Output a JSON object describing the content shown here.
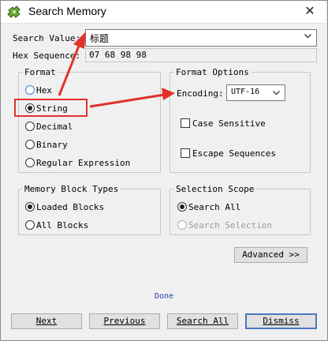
{
  "window": {
    "title": "Search Memory",
    "close_icon": "close-icon",
    "app_icon": "puzzle-icon"
  },
  "search": {
    "value_label": "Search Value:",
    "value": "标题",
    "hex_label": "Hex Sequence:",
    "hex_value": "07 68 98 98"
  },
  "format": {
    "legend": "Format",
    "options": [
      "Hex",
      "String",
      "Decimal",
      "Binary",
      "Regular Expression"
    ],
    "selected": "String"
  },
  "format_options": {
    "legend": "Format Options",
    "encoding_label": "Encoding:",
    "encoding_value": "UTF-16",
    "case_sensitive": "Case Sensitive",
    "escape_sequences": "Escape Sequences"
  },
  "memory_block": {
    "legend": "Memory Block Types",
    "options": [
      "Loaded Blocks",
      "All Blocks"
    ],
    "selected": "Loaded Blocks"
  },
  "selection_scope": {
    "legend": "Selection Scope",
    "options": [
      "Search All",
      "Search Selection"
    ],
    "selected": "Search All"
  },
  "buttons": {
    "advanced": "Advanced >>",
    "next": "Next",
    "previous": "Previous",
    "search_all": "Search All",
    "dismiss": "Dismiss"
  },
  "status": "Done",
  "colors": {
    "annotation": "#e0322b",
    "status_text": "#2342b5",
    "default_button_border": "#4a78c2"
  }
}
